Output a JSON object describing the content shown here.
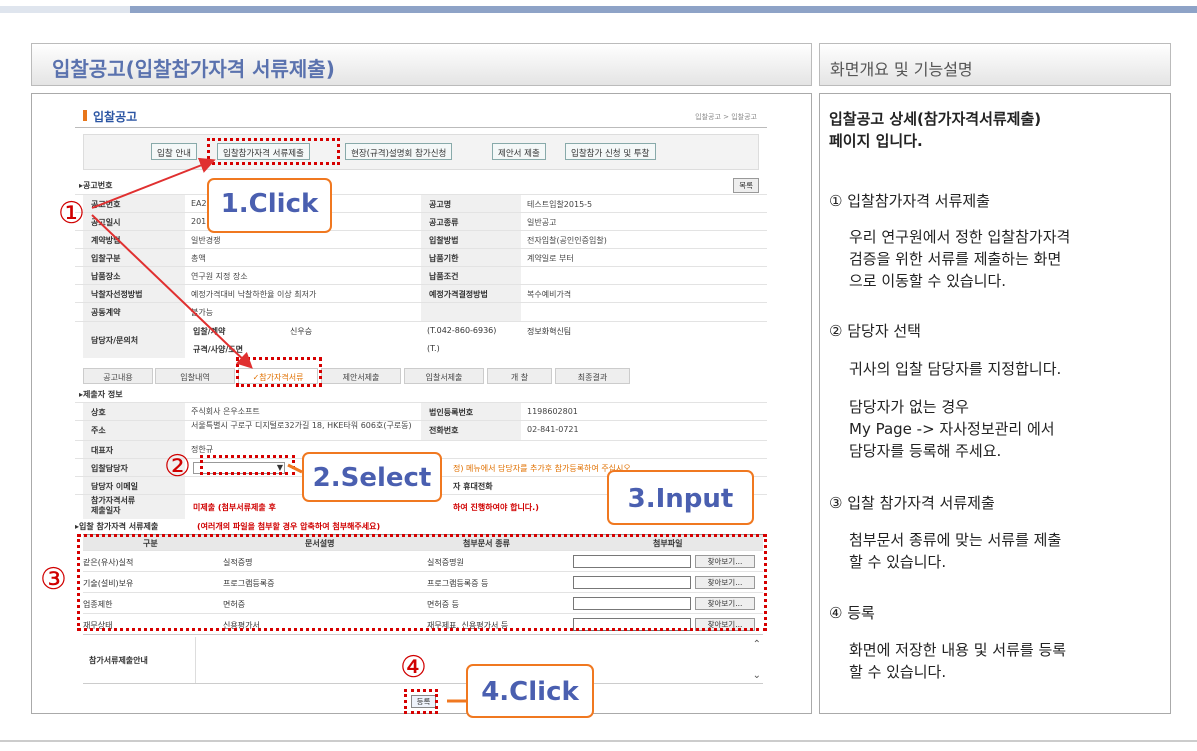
{
  "left_header": "입찰공고(입찰참가자격 서류제출)",
  "right_header": "화면개요 및 기능설명",
  "screen": {
    "page_title": "입찰공고",
    "breadcrumb": "입찰공고 > 입찰공고",
    "top_buttons": [
      "입찰 안내",
      "입찰참가자격 서류제출",
      "현장(규격)설명회 참가신청",
      "제안서 제출",
      "입찰참가 신청 및 투찰"
    ],
    "section_notice": "▸공고번호",
    "list_button": "목록",
    "rows": [
      {
        "l1": "공고번호",
        "v1": "EA2",
        "l2": "공고명",
        "v2": "테스트입찰2015-5"
      },
      {
        "l1": "공고일시",
        "v1": "201",
        "l2": "공고종류",
        "v2": "일반공고"
      },
      {
        "l1": "계약방법",
        "v1": "일반경쟁",
        "l2": "입찰방법",
        "v2": "전자입찰(공인인증입찰)"
      },
      {
        "l1": "입찰구분",
        "v1": "총액",
        "l2": "납품기한",
        "v2": "계약일로 부터"
      },
      {
        "l1": "납품장소",
        "v1": "연구원 지정 장소",
        "l2": "납품조건",
        "v2": ""
      },
      {
        "l1": "낙찰자선정방법",
        "v1": "예정가격대비 낙찰하한율 이상 최저가",
        "l2": "예정가격결정방법",
        "v2": "복수예비가격"
      },
      {
        "l1": "공동계약",
        "v1": "불가능",
        "l2": "",
        "v2": ""
      }
    ],
    "contact": {
      "label": "담당자/문의처",
      "sub1": "입찰/계약",
      "name": "신우승",
      "sub2": "규격/사양/도면",
      "phone": "(T.042-860-6936)",
      "dept": "정보화혁신팀",
      "phone2": "(T.)"
    },
    "tabs": [
      "공고내용",
      "입찰내역",
      "✓참가자격서류",
      "제안서제출",
      "입찰서제출",
      "개 찰",
      "최종결과"
    ],
    "section_submitter": "▸제출자 정보",
    "sub_rows": [
      {
        "l1": "상호",
        "v1": "주식회사 은우소프트",
        "l2": "법인등록번호",
        "v2": "1198602801"
      },
      {
        "l1": "주소",
        "v1": "서울특별시 구로구 디지털로32가길 18, HKE타워 606호(구로동)",
        "l2": "전화번호",
        "v2": "02-841-0721"
      },
      {
        "l1": "대표자",
        "v1": "정한규",
        "l2": "",
        "v2": ""
      }
    ],
    "manager_label": "입찰담당자",
    "manager_notice": "정) 메뉴에서 담당자를 추가후 참가등록하여 주십시오",
    "email_label": "담당자 이메일",
    "mobile_label": "자 휴대전화",
    "deadline_label": "참가자격서류\n제출일자",
    "deadline_value": "미제출 (첨부서류제출 후 ",
    "deadline_value2": "하여 진행하여야 합니다.)",
    "section_attach": "▸입찰 참가자격 서류제출",
    "attach_note": "(여러개의 파일을 첨부할 경우 압축하여 첨부해주세요)",
    "attach_headers": [
      "구분",
      "문서설명",
      "첨부문서 종류",
      "첨부파일"
    ],
    "attach_rows": [
      {
        "c1": "같은(유사)실적",
        "c2": "실적증명",
        "c3": "실적증명원"
      },
      {
        "c1": "기술(설비)보유",
        "c2": "프로그램등록증",
        "c3": "프로그램등록증 등"
      },
      {
        "c1": "업종제한",
        "c2": "면허증",
        "c3": "면허증 등"
      },
      {
        "c1": "재무상태",
        "c2": "신용평가서",
        "c3": "재무제표, 신용평가서 등"
      }
    ],
    "find_button": "찾아보기...",
    "guide_label": "참가서류제출안내",
    "register_button": "등록"
  },
  "callouts": {
    "c1": "1.Click",
    "c2": "2.Select",
    "c3": "3.Input",
    "c4": "4.Click"
  },
  "markers": {
    "m1": "①",
    "m2": "②",
    "m3": "③",
    "m4": "④"
  },
  "desc": {
    "intro1": "입찰공고 상세(참가자격서류제출)",
    "intro2": "페이지 입니다.",
    "s1_title": "① 입찰참가자격 서류제출",
    "s1_l1": "우리 연구원에서 정한 입찰참가자격",
    "s1_l2": "검증을 위한 서류를 제출하는 화면",
    "s1_l3": "으로 이동할 수 있습니다.",
    "s2_title": "② 담당자 선택",
    "s2_l1": "귀사의 입찰 담당자를 지정합니다.",
    "s2_l2": "담당자가 없는 경우",
    "s2_l3": "My Page -> 자사정보관리 에서",
    "s2_l4": "담당자를 등록해 주세요.",
    "s3_title": "③ 입찰 참가자격 서류제출",
    "s3_l1": "첨부문서 종류에 맞는 서류를 제출",
    "s3_l2": "할 수 있습니다.",
    "s4_title": "④ 등록",
    "s4_l1": "화면에 저장한 내용 및 서류를 등록",
    "s4_l2": "할 수 있습니다."
  }
}
